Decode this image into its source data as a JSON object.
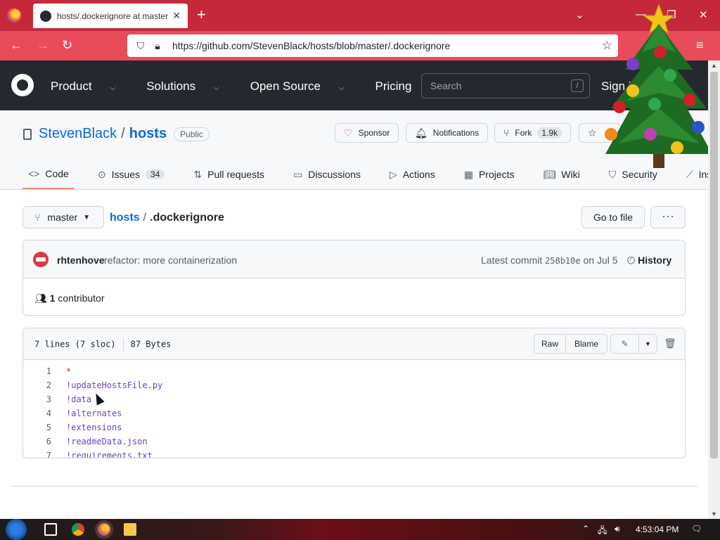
{
  "browser": {
    "tab_title": "hosts/.dockerignore at master",
    "new_tab": "+",
    "url": "https://github.com/StevenBlack/hosts/blob/master/.dockerignore"
  },
  "gh_header": {
    "nav": [
      "Product",
      "Solutions",
      "Open Source",
      "Pricing"
    ],
    "search_placeholder": "Search",
    "search_shortcut": "/",
    "signin": "Sign in"
  },
  "repo": {
    "owner": "StevenBlack",
    "separator": "/",
    "name": "hosts",
    "visibility": "Public",
    "sponsor": "Sponsor",
    "notifications": "Notifications",
    "fork": "Fork",
    "fork_count": "1.9k",
    "tabs": [
      {
        "label": "Code",
        "icon": "code-icon"
      },
      {
        "label": "Issues",
        "count": "34",
        "icon": "issue-icon"
      },
      {
        "label": "Pull requests",
        "icon": "pull-request-icon"
      },
      {
        "label": "Discussions",
        "icon": "discussion-icon"
      },
      {
        "label": "Actions",
        "icon": "play-icon"
      },
      {
        "label": "Projects",
        "icon": "table-icon"
      },
      {
        "label": "Wiki",
        "icon": "book-icon"
      },
      {
        "label": "Security",
        "icon": "shield-icon"
      },
      {
        "label": "Insights",
        "icon": "graph-icon"
      }
    ]
  },
  "file_nav": {
    "branch": "master",
    "crumb_repo": "hosts",
    "crumb_sep": "/",
    "crumb_file": ".dockerignore",
    "go_to_file": "Go to file",
    "more": "···"
  },
  "commit": {
    "author": "rhtenhove",
    "message": "refactor: more containerization",
    "latest_label": "Latest commit",
    "sha": "258b10e",
    "date": "on Jul 5",
    "history": "History",
    "contributors_count": "1",
    "contributors_label": "contributor"
  },
  "file": {
    "lines_info": "7 lines (7 sloc)",
    "size": "87 Bytes",
    "raw": "Raw",
    "blame": "Blame",
    "lines": [
      {
        "n": "1",
        "text": "*"
      },
      {
        "n": "2",
        "text": "!updateHostsFile.py"
      },
      {
        "n": "3",
        "text": "!data"
      },
      {
        "n": "4",
        "text": "!alternates"
      },
      {
        "n": "5",
        "text": "!extensions"
      },
      {
        "n": "6",
        "text": "!readmeData.json"
      },
      {
        "n": "7",
        "text": "!requirements.txt"
      }
    ]
  },
  "taskbar": {
    "clock": "4:53:04 PM"
  },
  "colors": {
    "tabbar": "#c5283b",
    "navbar": "#e84c5a",
    "gh_header": "#24292f",
    "link": "#0969da",
    "active_tab_underline": "#fd8c73"
  }
}
